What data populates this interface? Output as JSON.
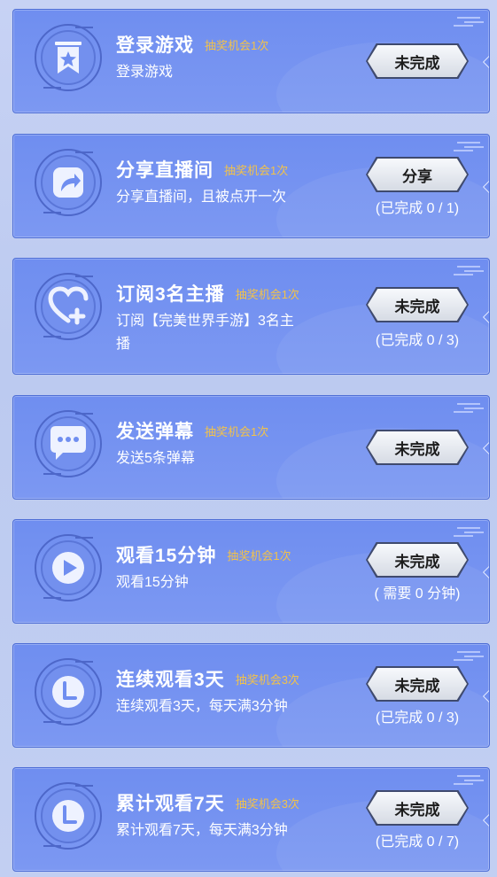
{
  "tasks": [
    {
      "title": "登录游戏",
      "chance": "抽奖机会1次",
      "desc": "登录游戏",
      "button": "未完成",
      "progress": "",
      "icon": "bookmark-star-icon"
    },
    {
      "title": "分享直播间",
      "chance": "抽奖机会1次",
      "desc": "分享直播间，且被点开一次",
      "button": "分享",
      "progress": "(已完成 0 / 1)",
      "icon": "share-arrow-icon"
    },
    {
      "title": "订阅3名主播",
      "chance": "抽奖机会1次",
      "desc": "订阅【完美世界手游】3名主播",
      "button": "未完成",
      "progress": "(已完成 0 / 3)",
      "icon": "heart-plus-icon"
    },
    {
      "title": "发送弹幕",
      "chance": "抽奖机会1次",
      "desc": "发送5条弹幕",
      "button": "未完成",
      "progress": "",
      "icon": "chat-bubble-icon"
    },
    {
      "title": "观看15分钟",
      "chance": "抽奖机会1次",
      "desc": "观看15分钟",
      "button": "未完成",
      "progress": "( 需要 0 分钟)",
      "icon": "play-icon"
    },
    {
      "title": "连续观看3天",
      "chance": "抽奖机会3次",
      "desc": "连续观看3天，每天满3分钟",
      "button": "未完成",
      "progress": "(已完成 0 / 3)",
      "icon": "clock-l-icon"
    },
    {
      "title": "累计观看7天",
      "chance": "抽奖机会3次",
      "desc": "累计观看7天，每天满3分钟",
      "button": "未完成",
      "progress": "(已完成 0 / 7)",
      "icon": "clock-l-icon"
    }
  ],
  "colors": {
    "card": "#6f8ef0",
    "chance": "#f2c24a",
    "border": "#4f6fd6"
  }
}
